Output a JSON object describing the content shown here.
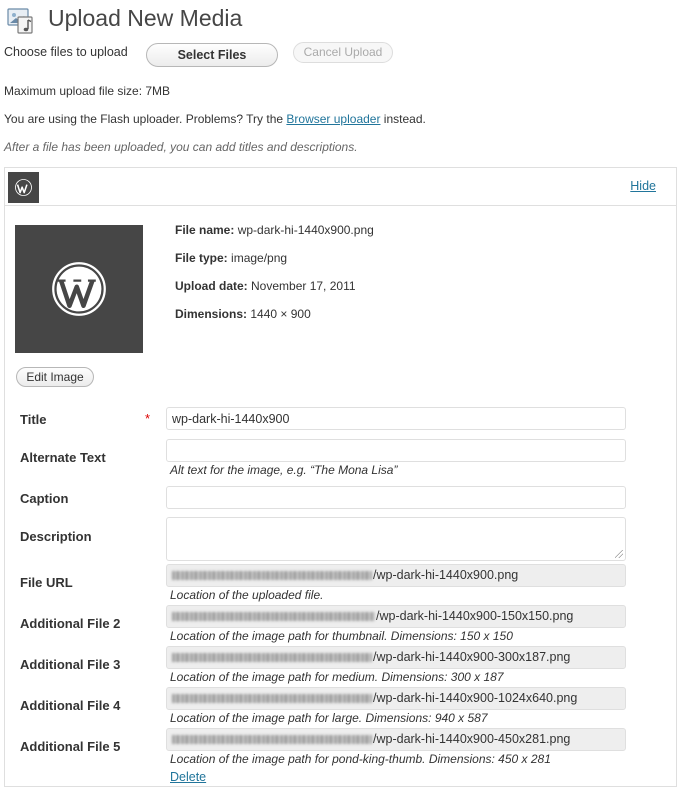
{
  "header": {
    "title": "Upload New Media",
    "icon": "media-library-icon"
  },
  "uploader": {
    "choose_label": "Choose files to upload",
    "select_files": "Select Files",
    "cancel_upload": "Cancel Upload",
    "max_size": "Maximum upload file size: 7MB",
    "flash_prefix": "You are using the Flash uploader. Problems? Try the ",
    "flash_link": "Browser uploader",
    "flash_suffix": " instead.",
    "after_note": "After a file has been uploaded, you can add titles and descriptions."
  },
  "media_item": {
    "hide_link": "Hide",
    "file_name_label": "File name:",
    "file_name": "wp-dark-hi-1440x900.png",
    "file_type_label": "File type:",
    "file_type": "image/png",
    "upload_date_label": "Upload date:",
    "upload_date": "November 17, 2011",
    "dimensions_label": "Dimensions:",
    "dimensions": "1440 × 900",
    "edit_image": "Edit Image",
    "delete_link": "Delete"
  },
  "fields": {
    "title": {
      "label": "Title",
      "required_mark": "*",
      "value": "wp-dark-hi-1440x900"
    },
    "alt_text": {
      "label": "Alternate Text",
      "value": "",
      "help": "Alt text for the image, e.g. “The Mona Lisa”"
    },
    "caption": {
      "label": "Caption",
      "value": ""
    },
    "description": {
      "label": "Description",
      "value": ""
    },
    "file_url": {
      "label": "File URL",
      "value_suffix": "/wp-dark-hi-1440x900.png",
      "help": "Location of the uploaded file."
    },
    "additional_2": {
      "label": "Additional File 2",
      "value_suffix": "/wp-dark-hi-1440x900-150x150.png",
      "help": "Location of the image path for thumbnail. Dimensions: 150 x 150"
    },
    "additional_3": {
      "label": "Additional File 3",
      "value_suffix": "/wp-dark-hi-1440x900-300x187.png",
      "help": "Location of the image path for medium. Dimensions: 300 x 187"
    },
    "additional_4": {
      "label": "Additional File 4",
      "value_suffix": "/wp-dark-hi-1440x900-1024x640.png",
      "help": "Location of the image path for large. Dimensions: 940 x 587"
    },
    "additional_5": {
      "label": "Additional File 5",
      "value_suffix": "/wp-dark-hi-1440x900-450x281.png",
      "help": "Location of the image path for pond-king-thumb. Dimensions: 450 x 281"
    }
  },
  "colors": {
    "link": "#21759b",
    "required": "#dd0000",
    "thumb_bg": "#464646",
    "readonly_bg": "#eeeeee"
  }
}
